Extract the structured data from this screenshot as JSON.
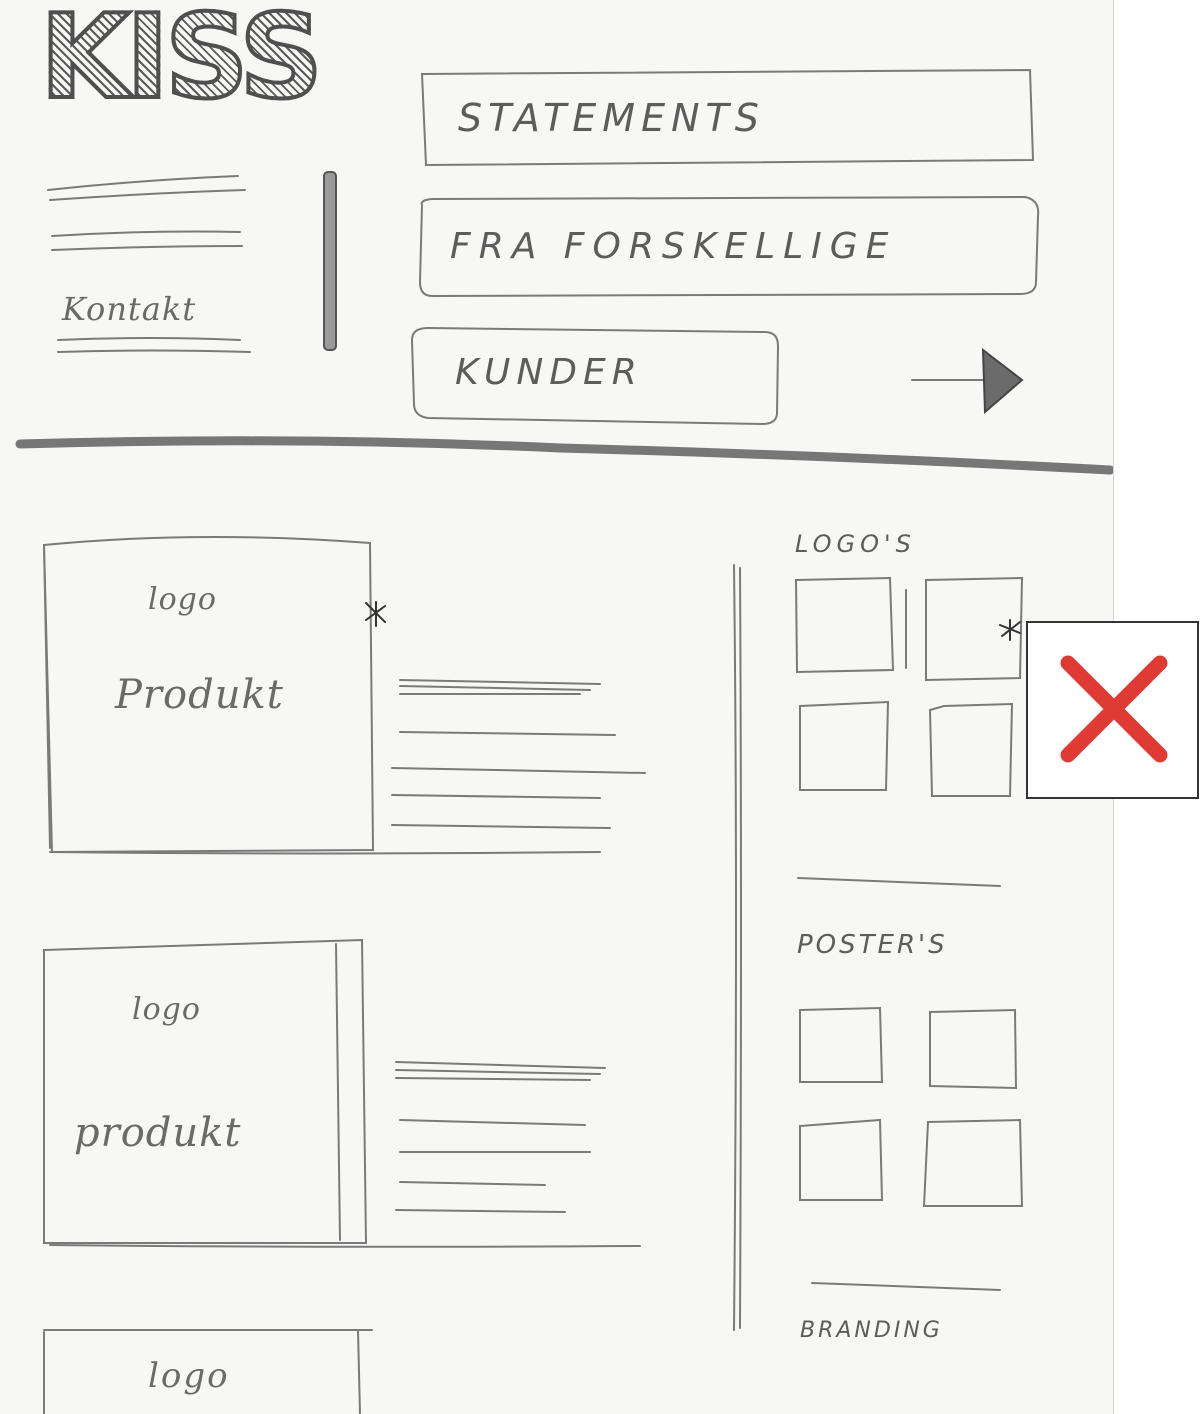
{
  "brand": {
    "logo": "KISS"
  },
  "nav": {
    "contact_label": "Kontakt"
  },
  "hero": {
    "statements": [
      "STATEMENTS",
      "FRA FORSKELLIGE",
      "KUNDER"
    ]
  },
  "products": [
    {
      "logo_label": "logo",
      "product_label": "Produkt"
    },
    {
      "logo_label": "logo",
      "product_label": "produkt"
    },
    {
      "logo_label": "logo"
    }
  ],
  "sidebar": {
    "sections": [
      {
        "title": "LOGO'S"
      },
      {
        "title": "POSTER'S"
      },
      {
        "title": "BRANDING"
      }
    ]
  },
  "icons": {
    "next_arrow": "arrow-right-icon",
    "close": "close-icon",
    "close_color": "#e03a34"
  }
}
